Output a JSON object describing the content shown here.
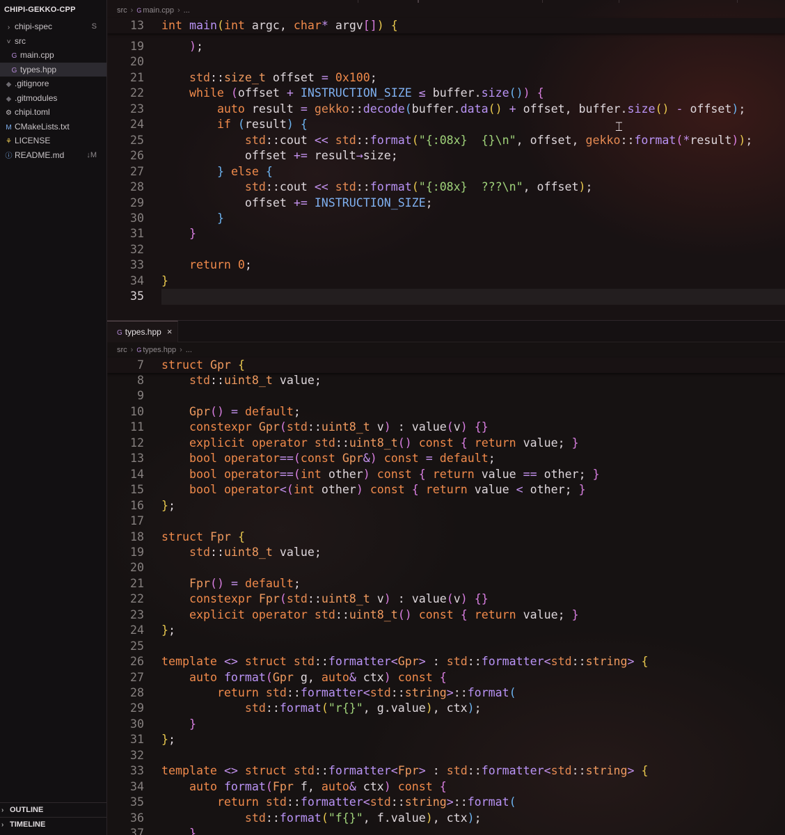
{
  "explorer": {
    "root_label": "CHIPI-GEKKO-CPP",
    "items": [
      {
        "label": "chipi-spec",
        "icon": "chevron-right-icon",
        "indent": 0,
        "badge": "S",
        "selected": false
      },
      {
        "label": "src",
        "icon": "chevron-down-icon",
        "indent": 0,
        "badge": "",
        "selected": false
      },
      {
        "label": "main.cpp",
        "icon": "cpp-file-icon",
        "indent": 1,
        "badge": "",
        "selected": false
      },
      {
        "label": "types.hpp",
        "icon": "cpp-file-icon",
        "indent": 1,
        "badge": "",
        "selected": true
      },
      {
        "label": ".gitignore",
        "icon": "git-file-icon",
        "indent": 0,
        "badge": "",
        "selected": false
      },
      {
        "label": ".gitmodules",
        "icon": "git-file-icon",
        "indent": 0,
        "badge": "",
        "selected": false
      },
      {
        "label": "chipi.toml",
        "icon": "gear-file-icon",
        "indent": 0,
        "badge": "",
        "selected": false
      },
      {
        "label": "CMakeLists.txt",
        "icon": "cmake-file-icon",
        "indent": 0,
        "badge": "",
        "selected": false
      },
      {
        "label": "LICENSE",
        "icon": "license-file-icon",
        "indent": 0,
        "badge": "",
        "selected": false
      },
      {
        "label": "README.md",
        "icon": "info-file-icon",
        "indent": 0,
        "badge": "↓M",
        "selected": false
      }
    ],
    "outline_label": "OUTLINE",
    "timeline_label": "TIMELINE"
  },
  "editor_top": {
    "breadcrumb": [
      "src",
      "main.cpp",
      "..."
    ],
    "sticky": {
      "num": "13",
      "code": "int main(int argc, char* argv[]) {"
    },
    "lines": [
      {
        "num": "19",
        "code": "    );"
      },
      {
        "num": "20",
        "code": ""
      },
      {
        "num": "21",
        "code": "    std::size_t offset = 0x100;"
      },
      {
        "num": "22",
        "code": "    while (offset + INSTRUCTION_SIZE ≤ buffer.size()) {"
      },
      {
        "num": "23",
        "code": "        auto result = gekko::decode(buffer.data() + offset, buffer.size() - offset);"
      },
      {
        "num": "24",
        "code": "        if (result) {"
      },
      {
        "num": "25",
        "code": "            std::cout << std::format(\"{:08x}  {}\\n\", offset, gekko::format(*result));"
      },
      {
        "num": "26",
        "code": "            offset += result→size;"
      },
      {
        "num": "27",
        "code": "        } else {"
      },
      {
        "num": "28",
        "code": "            std::cout << std::format(\"{:08x}  ???\\n\", offset);"
      },
      {
        "num": "29",
        "code": "            offset += INSTRUCTION_SIZE;"
      },
      {
        "num": "30",
        "code": "        }"
      },
      {
        "num": "31",
        "code": "    }"
      },
      {
        "num": "32",
        "code": ""
      },
      {
        "num": "33",
        "code": "    return 0;"
      },
      {
        "num": "34",
        "code": "}"
      },
      {
        "num": "35",
        "code": ""
      }
    ]
  },
  "editor_bottom": {
    "tab_label": "types.hpp",
    "tab_close": "×",
    "breadcrumb": [
      "src",
      "types.hpp",
      "..."
    ],
    "sticky": {
      "num": "7",
      "code": "struct Gpr {"
    },
    "lines": [
      {
        "num": "8",
        "code": "    std::uint8_t value;"
      },
      {
        "num": "9",
        "code": ""
      },
      {
        "num": "10",
        "code": "    Gpr() = default;"
      },
      {
        "num": "11",
        "code": "    constexpr Gpr(std::uint8_t v) : value(v) {}"
      },
      {
        "num": "12",
        "code": "    explicit operator std::uint8_t() const { return value; }"
      },
      {
        "num": "13",
        "code": "    bool operator==(const Gpr&) const = default;"
      },
      {
        "num": "14",
        "code": "    bool operator==(int other) const { return value == other; }"
      },
      {
        "num": "15",
        "code": "    bool operator<(int other) const { return value < other; }"
      },
      {
        "num": "16",
        "code": "};"
      },
      {
        "num": "17",
        "code": ""
      },
      {
        "num": "18",
        "code": "struct Fpr {"
      },
      {
        "num": "19",
        "code": "    std::uint8_t value;"
      },
      {
        "num": "20",
        "code": ""
      },
      {
        "num": "21",
        "code": "    Fpr() = default;"
      },
      {
        "num": "22",
        "code": "    constexpr Fpr(std::uint8_t v) : value(v) {}"
      },
      {
        "num": "23",
        "code": "    explicit operator std::uint8_t() const { return value; }"
      },
      {
        "num": "24",
        "code": "};"
      },
      {
        "num": "25",
        "code": ""
      },
      {
        "num": "26",
        "code": "template <> struct std::formatter<Gpr> : std::formatter<std::string> {"
      },
      {
        "num": "27",
        "code": "    auto format(Gpr g, auto& ctx) const {"
      },
      {
        "num": "28",
        "code": "        return std::formatter<std::string>::format("
      },
      {
        "num": "29",
        "code": "            std::format(\"r{}\", g.value), ctx);"
      },
      {
        "num": "30",
        "code": "    }"
      },
      {
        "num": "31",
        "code": "};"
      },
      {
        "num": "32",
        "code": ""
      },
      {
        "num": "33",
        "code": "template <> struct std::formatter<Fpr> : std::formatter<std::string> {"
      },
      {
        "num": "34",
        "code": "    auto format(Fpr f, auto& ctx) const {"
      },
      {
        "num": "35",
        "code": "        return std::formatter<std::string>::format("
      },
      {
        "num": "36",
        "code": "            std::format(\"f{}\", f.value), ctx);"
      },
      {
        "num": "37",
        "code": "    }"
      }
    ]
  },
  "colors": {
    "keyword": "#f08a4b",
    "function": "#b993f5",
    "string": "#9fd27a",
    "bracket_yellow": "#e8c84e",
    "bracket_magenta": "#d87ee0",
    "bracket_blue": "#6cb3f0",
    "macro": "#7fb0f0",
    "line_number": "#86807f"
  }
}
